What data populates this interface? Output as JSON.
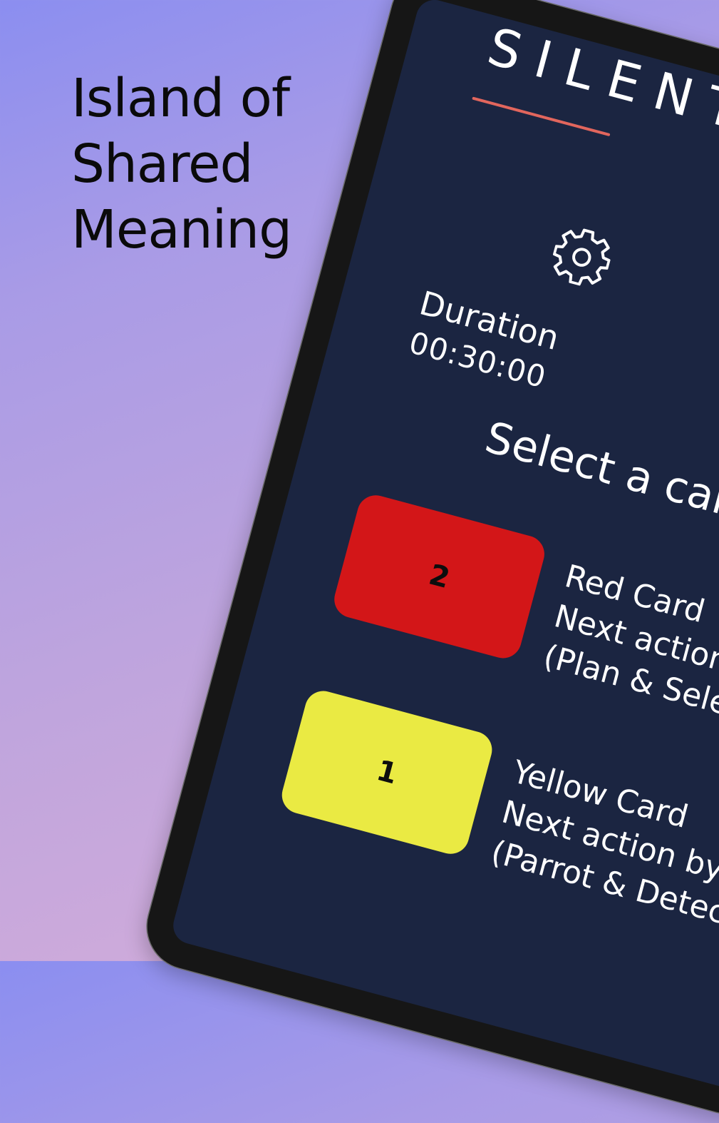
{
  "headline": {
    "line1": "Island of",
    "line2": "Shared",
    "line3": "Meaning"
  },
  "app": {
    "logo_text": "SILENT",
    "accent_color": "#e2665d",
    "screen_bg": "#1b2541"
  },
  "settings": {
    "icon": "gear-icon",
    "duration_label": "Duration",
    "duration_value": "00:30:00"
  },
  "selection": {
    "title": "Select a card"
  },
  "cards": [
    {
      "number": "2",
      "color": "#d31618",
      "title": "Red Card",
      "line2": "Next action by",
      "line3": "(Plan & Select)"
    },
    {
      "number": "1",
      "color": "#eaea43",
      "title": "Yellow Card",
      "line2": "Next action by",
      "line3": "(Parrot & Detect)"
    }
  ]
}
